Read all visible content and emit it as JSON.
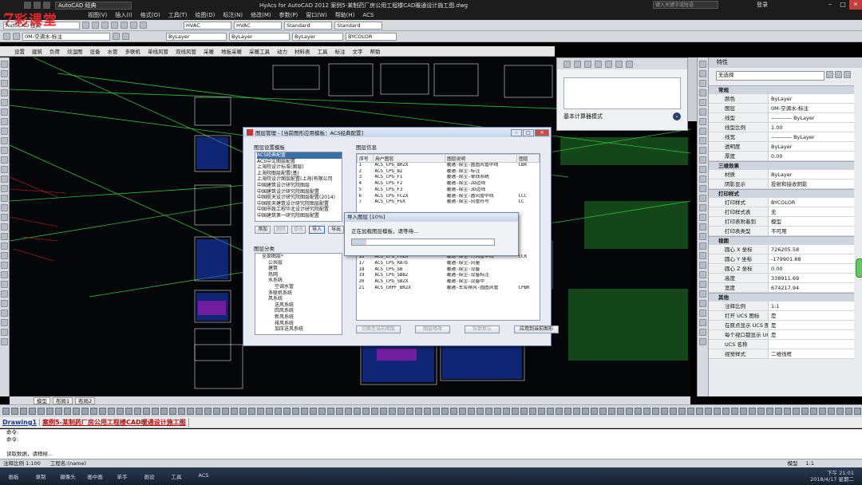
{
  "titlebar": {
    "workspace": "AutoCAD 经典",
    "app_title": "HyAcs for AutoCAD 2012   案例5-某制药厂房公用工程楼CAD暖通设计施工图.dwg",
    "search_placeholder": "键入关键字或短语",
    "login": "登录"
  },
  "menubar": [
    "视图(V)",
    "插入(I)",
    "格式(O)",
    "工具(T)",
    "绘图(D)",
    "标注(N)",
    "修改(M)",
    "参数(P)",
    "窗口(W)",
    "帮助(H)",
    "ACS"
  ],
  "toolbar_row2": {
    "workspace_select": "AutoCAD 经典",
    "layer_select": "0M-空调水-标注",
    "style1": "HVAC",
    "style2": "HVAC",
    "style3": "Standard",
    "style4": "Standard"
  },
  "toolbar_row3": {
    "color": "ByLayer",
    "linetype": "ByLayer",
    "lineweight": "ByLayer",
    "plotstyle": "BYCOLOR"
  },
  "acs_menu": [
    "设置",
    "建筑",
    "负荷",
    "焓湿图",
    "设备",
    "水管",
    "多联机",
    "单线风管",
    "双线风管",
    "采暖",
    "地板采暖",
    "采暖工具",
    "动力",
    "材料表",
    "工具",
    "标注",
    "文字",
    "帮助"
  ],
  "watermark": {
    "num": "7",
    "text": "彩课堂"
  },
  "calc_panel": {
    "mode_label": "基本计算器模式"
  },
  "properties": {
    "header": "特性",
    "selection": "无选择",
    "sections": [
      {
        "title": "常规",
        "rows": [
          {
            "k": "颜色",
            "v": "ByLayer"
          },
          {
            "k": "图层",
            "v": "0M-空调水-标注"
          },
          {
            "k": "线型",
            "v": "———— ByLayer"
          },
          {
            "k": "线型比例",
            "v": "1.00"
          },
          {
            "k": "线宽",
            "v": "———— ByLayer"
          },
          {
            "k": "透明度",
            "v": "ByLayer"
          },
          {
            "k": "厚度",
            "v": "0.00"
          }
        ]
      },
      {
        "title": "三维效果",
        "rows": [
          {
            "k": "材质",
            "v": "ByLayer"
          },
          {
            "k": "阴影显示",
            "v": "投射和接收阴影"
          }
        ]
      },
      {
        "title": "打印样式",
        "rows": [
          {
            "k": "打印样式",
            "v": "BYCOLOR"
          },
          {
            "k": "打印样式表",
            "v": "无"
          },
          {
            "k": "打印表附着到",
            "v": "模型"
          },
          {
            "k": "打印表类型",
            "v": "不可用"
          }
        ]
      },
      {
        "title": "视图",
        "rows": [
          {
            "k": "圆心 X 坐标",
            "v": "726205.58"
          },
          {
            "k": "圆心 Y 坐标",
            "v": "-179901.88"
          },
          {
            "k": "圆心 Z 坐标",
            "v": "0.00"
          },
          {
            "k": "高度",
            "v": "338911.69"
          },
          {
            "k": "宽度",
            "v": "674217.94"
          }
        ]
      },
      {
        "title": "其他",
        "rows": [
          {
            "k": "注释比例",
            "v": "1:1"
          },
          {
            "k": "打开 UCS 图标",
            "v": "是"
          },
          {
            "k": "在原点显示 UCS 图标",
            "v": "是"
          },
          {
            "k": "每个视口都显示 UCS",
            "v": "是"
          },
          {
            "k": "UCS 名称",
            "v": ""
          },
          {
            "k": "视觉样式",
            "v": "二维线框"
          }
        ]
      }
    ]
  },
  "dialog": {
    "title": "图层管理 - [当前图形应用模板：ACS经典配置]",
    "template_label": "图层设置模板",
    "templates": [
      "ACS经典配置",
      "ACS中文图层配置",
      "上海院设计标准(图层)",
      "上海院图层配置(基)",
      "上海院设计图层配置(上海)有限公司",
      "中国建筑设计研究院图层",
      "中国建筑设计研究院图层配置",
      "中国航天设计研究院图层配置(2014)",
      "中国航天建筑设计研究院图层配置",
      "中国市政工程华北设计研究院配置",
      "中国建筑第一研究院图层配置"
    ],
    "btn_add": "添加",
    "btn_delete": "删除",
    "btn_modify": "修改",
    "btn_import": "导入",
    "btn_export": "导出",
    "category_label": "图层分类",
    "categories": [
      "全部图层*",
      "公共层",
      "建筑",
      "热网",
      "水系统",
      "空调水管",
      "多联机系统",
      "风系统",
      "送风系统",
      "回风系统",
      "新风系统",
      "排风系统",
      "加压送风系统"
    ],
    "info_label": "图层信息",
    "table_headers": [
      "序号",
      "用户图层",
      "图层说明",
      "图层"
    ],
    "layers": [
      {
        "n": "1",
        "name": "ACS_CPG_BRZX",
        "desc": "暖通-除尘-圆图风管中线",
        "c": "CBR"
      },
      {
        "n": "2",
        "name": "ACS_CPG_BZ",
        "desc": "暖通-除尘-标注",
        "c": ""
      },
      {
        "n": "3",
        "name": "ACS_CPG_F1",
        "desc": "暖通-除尘-单线系统",
        "c": ""
      },
      {
        "n": "4",
        "name": "ACS_CPG_F2",
        "desc": "暖通-除尘-2D边线",
        "c": ""
      },
      {
        "n": "5",
        "name": "ACS_CPG_F3",
        "desc": "暖通-除尘-3D边线",
        "c": ""
      },
      {
        "n": "6",
        "name": "ACS_CPG_FCZX",
        "desc": "暖通-除尘-圆风管中线",
        "c": "CCC"
      },
      {
        "n": "7",
        "name": "ACS_CPG_FGX",
        "desc": "暖通-除尘-风管符号",
        "c": "CC"
      },
      {
        "n": "14",
        "name": "ACS_CPG_FM_H",
        "desc": "暖通-除尘-阀门-电动",
        "c": ""
      },
      {
        "n": "15",
        "name": "ACS_CPG_FM_F",
        "desc": "暖通-除尘-阀门-消防",
        "c": ""
      },
      {
        "n": "16",
        "name": "ACS_CPG_FRZX",
        "desc": "暖通-除尘-方风管中线",
        "c": "CCR"
      },
      {
        "n": "17",
        "name": "ACS_CPG_RATE",
        "desc": "暖通-除尘-风量",
        "c": ""
      },
      {
        "n": "18",
        "name": "ACS_CPG_SB",
        "desc": "暖通-除尘-设备",
        "c": ""
      },
      {
        "n": "19",
        "name": "ACS_CPG_SBBZ",
        "desc": "暖通-除尘-设备标注",
        "c": ""
      },
      {
        "n": "20",
        "name": "ACS_CPG_SBZX",
        "desc": "暖通-除尘-设备中",
        "c": ""
      },
      {
        "n": "21",
        "name": "ACS_CRPF_BRZX",
        "desc": "暖通-车库排风-圆图风管",
        "c": "CPBR"
      }
    ],
    "btn_switch": "切换至当前图层",
    "btn_modify_layer": "图层修改",
    "btn_restore": "恢复默认",
    "btn_apply": "应用到当前图形"
  },
  "progress": {
    "title": "导入图层 [10%]",
    "message": "正在加载图层模板，请等待...",
    "percent": 10
  },
  "layout_tabs": [
    "模型",
    "布局1",
    "布局2"
  ],
  "doc_tabs": [
    "Drawing1",
    "案例5-某制药厂房公用工程楼CAD暖通设计施工图"
  ],
  "command_lines": [
    "命令:",
    "命令:",
    "读取数据，请稍候..."
  ],
  "status": {
    "scale": "注释比例 1:100",
    "project": "工程名:(name)",
    "model": "模型",
    "zoom": "1:1"
  },
  "taskbar": [
    "画板",
    "录制",
    "摄像头",
    "画中画",
    "单手",
    "画设",
    "工具",
    "ACS"
  ],
  "clock": {
    "time": "下午 21:01",
    "date": "2018/4/17 星期二"
  }
}
